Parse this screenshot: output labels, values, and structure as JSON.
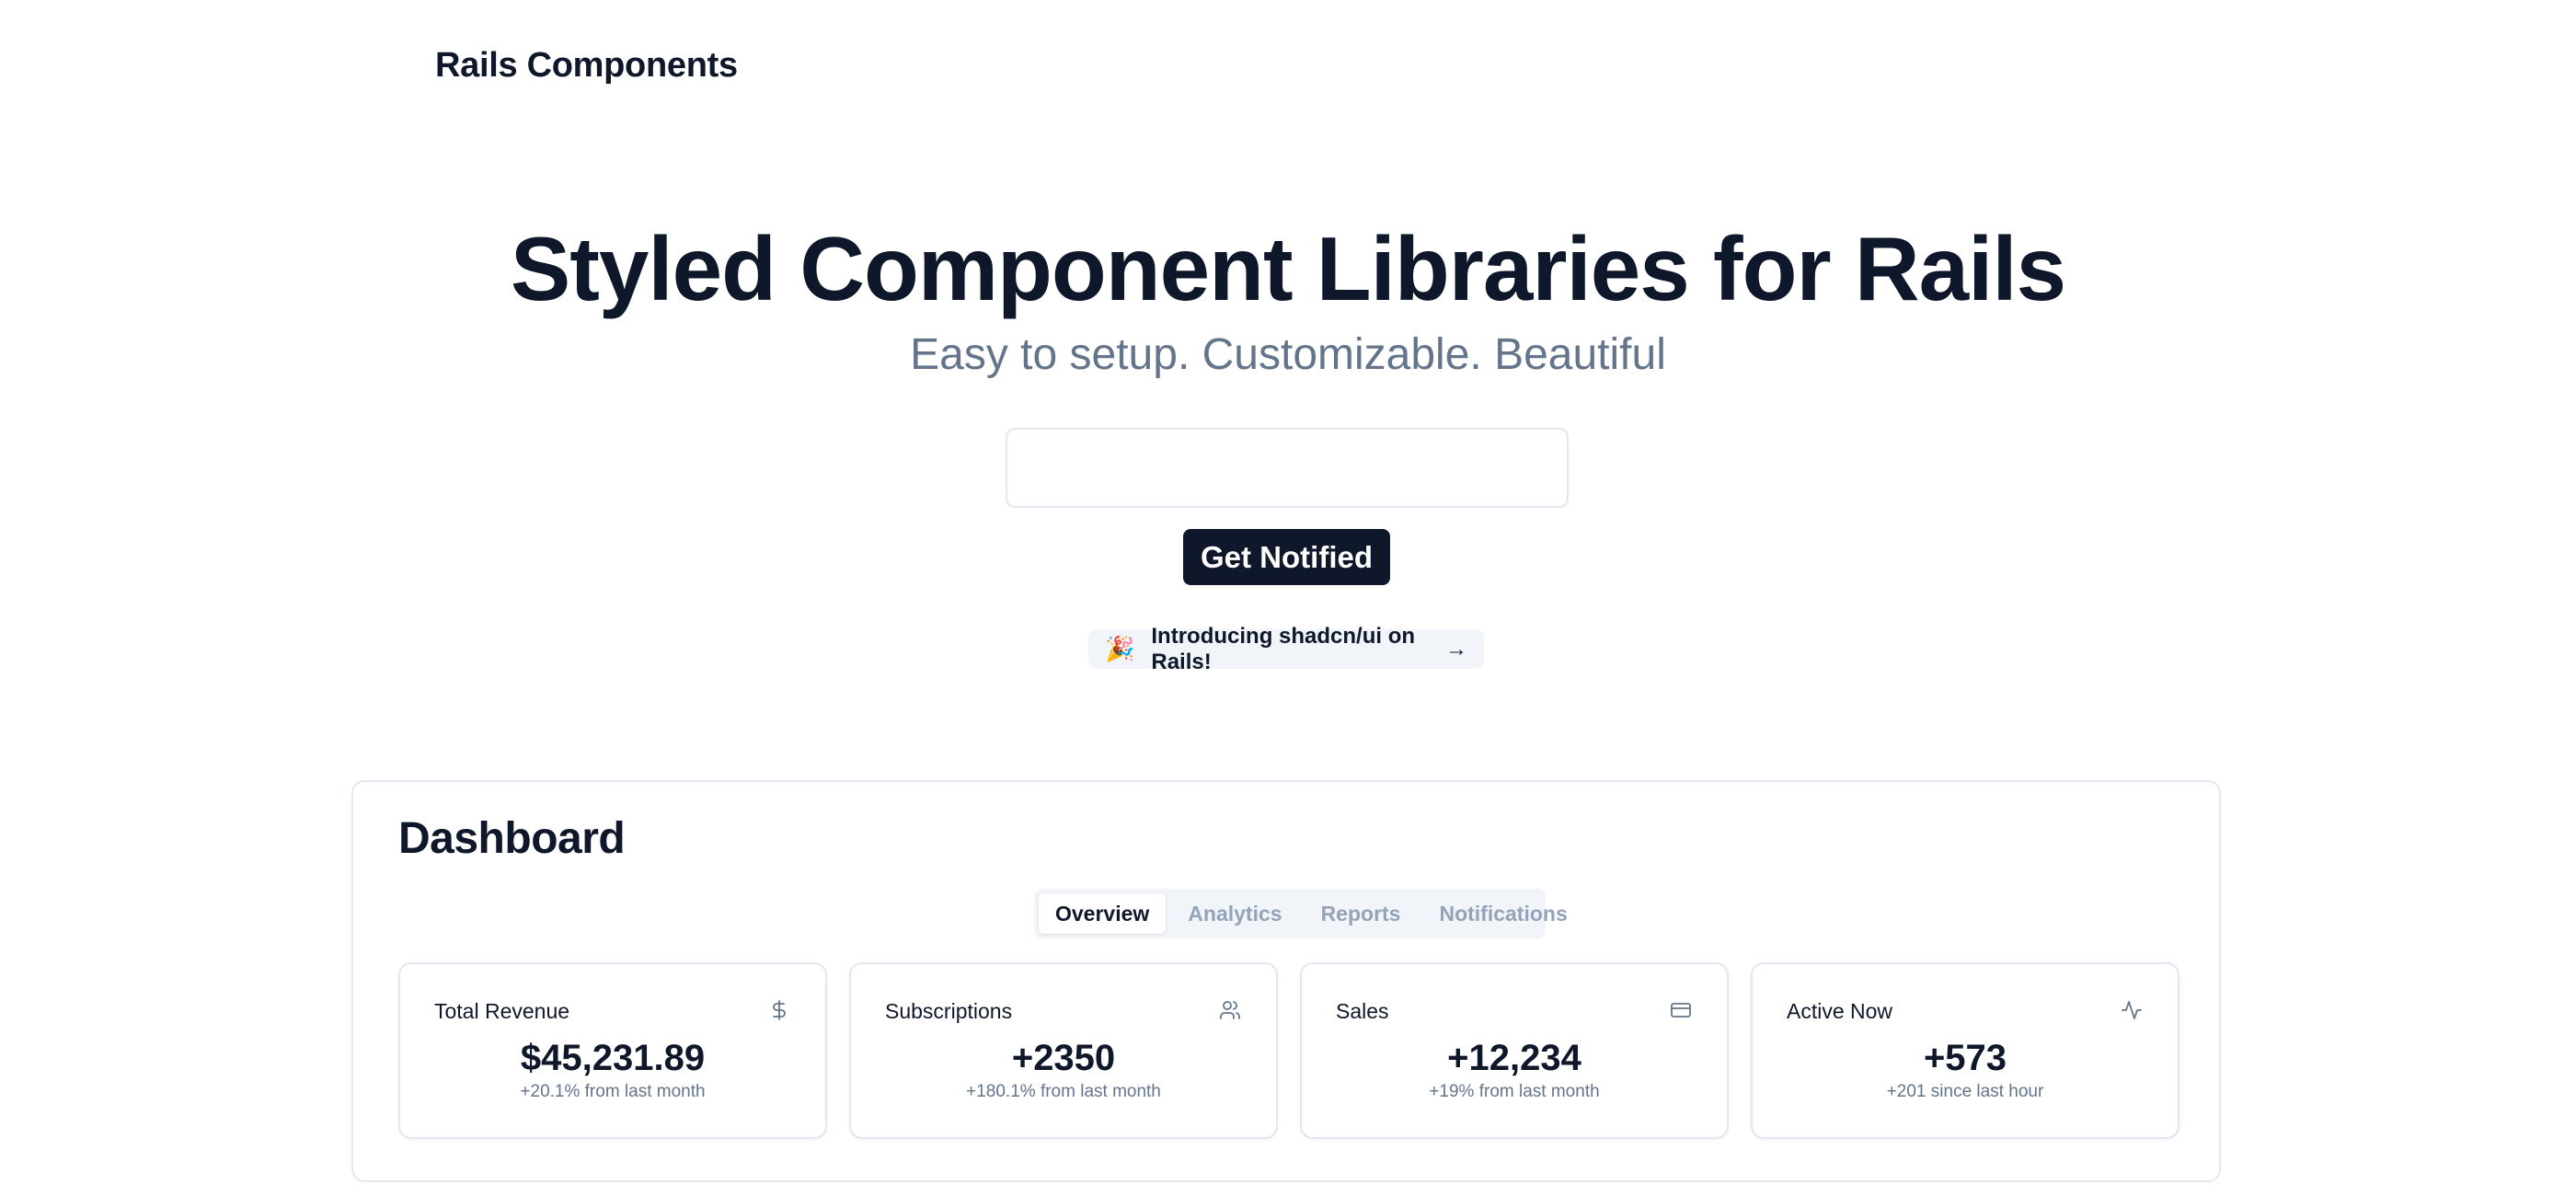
{
  "header": {
    "brand": "Rails Components"
  },
  "hero": {
    "title": "Styled Component Libraries for Rails",
    "subtitle": "Easy to setup. Customizable. Beautiful",
    "email_value": "",
    "email_placeholder": "",
    "cta_label": "Get Notified",
    "announcement_icon": "party-popper-icon",
    "announcement": "Introducing shadcn/ui on Rails!",
    "announcement_arrow": "→"
  },
  "dashboard": {
    "title": "Dashboard",
    "tabs": [
      {
        "label": "Overview",
        "active": true
      },
      {
        "label": "Analytics",
        "active": false
      },
      {
        "label": "Reports",
        "active": false
      },
      {
        "label": "Notifications",
        "active": false
      }
    ],
    "cards": [
      {
        "title": "Total Revenue",
        "icon": "dollar-sign-icon",
        "value": "$45,231.89",
        "note": "+20.1% from last month"
      },
      {
        "title": "Subscriptions",
        "icon": "users-icon",
        "value": "+2350",
        "note": "+180.1% from last month"
      },
      {
        "title": "Sales",
        "icon": "credit-card-icon",
        "value": "+12,234",
        "note": "+19% from last month"
      },
      {
        "title": "Active Now",
        "icon": "activity-icon",
        "value": "+573",
        "note": "+201 since last hour"
      }
    ]
  },
  "colors": {
    "primary": "#0f172a",
    "muted_text": "#64748b",
    "border": "#e2e8f0",
    "muted_bg": "#f1f5f9"
  }
}
